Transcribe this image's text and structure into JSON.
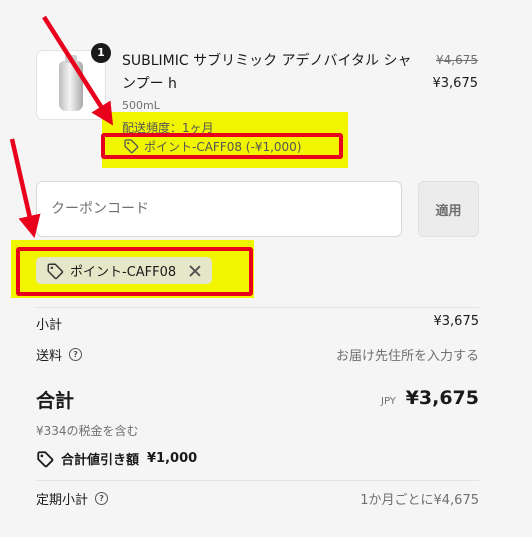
{
  "product": {
    "quantity": "1",
    "title": "SUBLIMIC サブリミック アデノバイタル シャンプー h",
    "price_original": "¥4,675",
    "price_current": "¥3,675",
    "variant": "500mL",
    "frequency": "配送頻度：1ヶ月",
    "discount_line": "ポイント-CAFF08 (-¥1,000)"
  },
  "coupon": {
    "placeholder": "クーポンコード",
    "apply_label": "適用",
    "applied_code": "ポイント-CAFF08"
  },
  "summary": {
    "subtotal_label": "小計",
    "subtotal_value": "¥3,675",
    "shipping_label": "送料",
    "shipping_value": "お届け先住所を入力する",
    "total_label": "合計",
    "currency": "JPY",
    "total_value": "¥3,675",
    "tax_note": "¥334の税金を含む",
    "savings_label": "合計値引き額",
    "savings_value": "¥1,000",
    "recurring_label": "定期小計",
    "recurring_value": "1か月ごとに¥4,675"
  },
  "colors": {
    "highlight": "#f1f500",
    "annotation_red": "#e8001c"
  },
  "icons": [
    "tag-icon",
    "close-icon",
    "question-circle-icon",
    "product-bottle-image"
  ]
}
